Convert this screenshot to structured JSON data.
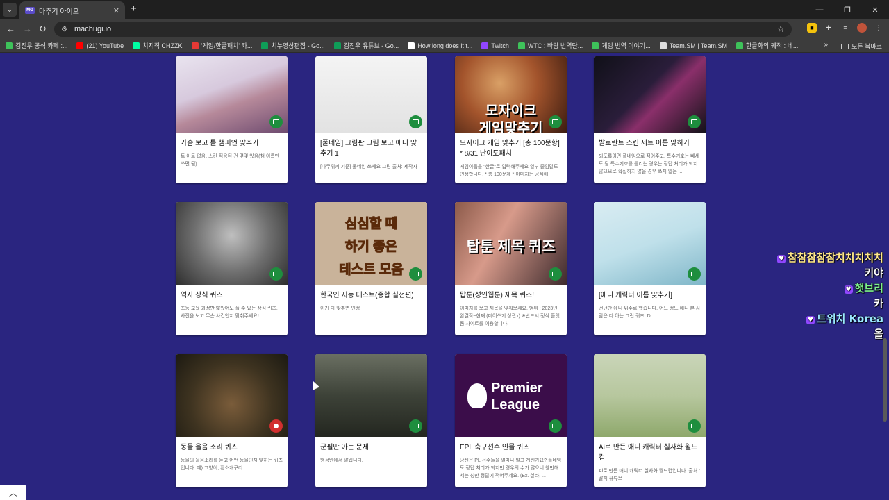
{
  "browser": {
    "tab_title": "마추기 아이오",
    "url": "machugi.io",
    "bookmarks": [
      {
        "label": "김진우 공식 카페 :...",
        "color": "#3ec25a"
      },
      {
        "label": "(21) YouTube",
        "color": "#ff0000"
      },
      {
        "label": "치지직 CHZZK",
        "color": "#00ffa3"
      },
      {
        "label": "'게임/한글패치' 카...",
        "color": "#e53935"
      },
      {
        "label": "치누영상편집 - Go...",
        "color": "#0f9d58"
      },
      {
        "label": "김진우 유튜브 - Go...",
        "color": "#0f9d58"
      },
      {
        "label": "How long does it t...",
        "color": "#ffffff"
      },
      {
        "label": "Twitch",
        "color": "#9146ff"
      },
      {
        "label": "WTC : 바람 번역단...",
        "color": "#3ec25a"
      },
      {
        "label": "게임 번역 이야기...",
        "color": "#3ec25a"
      },
      {
        "label": "Team.SM | Team.SM",
        "color": "#dddddd"
      },
      {
        "label": "한글화의 궤적 : 네...",
        "color": "#3ec25a"
      }
    ],
    "bookmarks_all": "모든 북마크"
  },
  "cards": [
    {
      "title": "가슴 보고 롤 챔피언 맞추기",
      "desc": "트 아트 없음, 스킨 적용된 건 몇몇 있음(챔 이름만 쓰면 됨)",
      "type": "image"
    },
    {
      "title": "[풀네임] 그림판 그림 보고 애니 맞추기 1",
      "desc": "[나무위키 기준] 풀네임 쓰세요 그림 출처: 제작자",
      "type": "image"
    },
    {
      "title": "모자이크 게임 맞추기 [총 100문항] * 8/31 난이도패치",
      "desc": "게임이름을 \"한글\"로 입력해주세요 일부 줄임말도 인정합니다. * 총 100문제 * 이미지는 공식에",
      "type": "image",
      "thumb_text": "모자이크 게임맞추기"
    },
    {
      "title": "발로란트 스킨 세트 이름 맞히기",
      "desc": "되도록이면 풀네임으로 적어주고, 특수기호는 빼세도 됨 특수기호를 틀리는 경우는 정답 처리가 되지 않으므로 확실하지 않을 경우 쓰지 않는 ...",
      "type": "image"
    },
    {
      "title": "역사 상식 퀴즈",
      "desc": "초등 교육 과정만 밟았어도 풀 수 있는 상식 퀴즈. 사진을 보고 무슨 사건인지 맞춰주세요!",
      "type": "image"
    },
    {
      "title": "한국인 지능 테스트(종합 실전편)",
      "desc": "이거 다 맞추면 인정",
      "type": "image",
      "thumb_text": "심심할 때 하기 좋은 테스트 모음"
    },
    {
      "title": "탑툰(성인웹툰) 제목 퀴즈!",
      "desc": "이미지를 보고 제목을 맞춰보세요. 범위 : 2023년 완결작~현재 (미어쓰기 상관x) ※반드시 정식 플랫폼 사이트를 이용합니다.",
      "type": "image",
      "thumb_text": "탑툰 제목 퀴즈"
    },
    {
      "title": "[애니 캐릭터 이름 맞추기]",
      "desc": "건던만 애니 위주로 했습니다. 어느 정도 애니 본 사람은 다 아는 그런 퀴즈 :D",
      "type": "image"
    },
    {
      "title": "동물 울음 소리 퀴즈",
      "desc": "동물의 울음소리를 듣고 어떤 동물인지 맞히는 퀴즈입니다. 예) 고양이, 황소개구리",
      "type": "video"
    },
    {
      "title": "군필만 아는 문제",
      "desc": "행정반에서 알립니다.",
      "type": "image"
    },
    {
      "title": "EPL 축구선수 인물 퀴즈",
      "desc": "당신은 PL 선수들을 얼마나 알고 계신가요? 풀네임도 정답 처리가 되지만 경우의 수가 많으니 웬만해서는 성만 정답에 적어주세요. (Ex. 살라, ...",
      "type": "image",
      "thumb_text": "Premier League"
    },
    {
      "title": "Ai로 만든 애니 캐릭터 실사화 월드컵",
      "desc": "Ai로 만든 애니 캐릭터 실사화 월드컵입니다. 출처 : 갈치 유튜브",
      "type": "image"
    }
  ],
  "chat": [
    {
      "name": "참참참참참치치치치치",
      "msg": "키야",
      "name_color": "#ffe88a"
    },
    {
      "name": "햇브리",
      "msg": "카",
      "name_color": "#7df08a"
    },
    {
      "name": "트위치 Korea",
      "msg": "올",
      "name_color": "#9be7ff"
    }
  ],
  "icons": {
    "image_badge": "image-icon",
    "video_badge": "play-icon",
    "scroll_top": "chevron-up-icon"
  }
}
